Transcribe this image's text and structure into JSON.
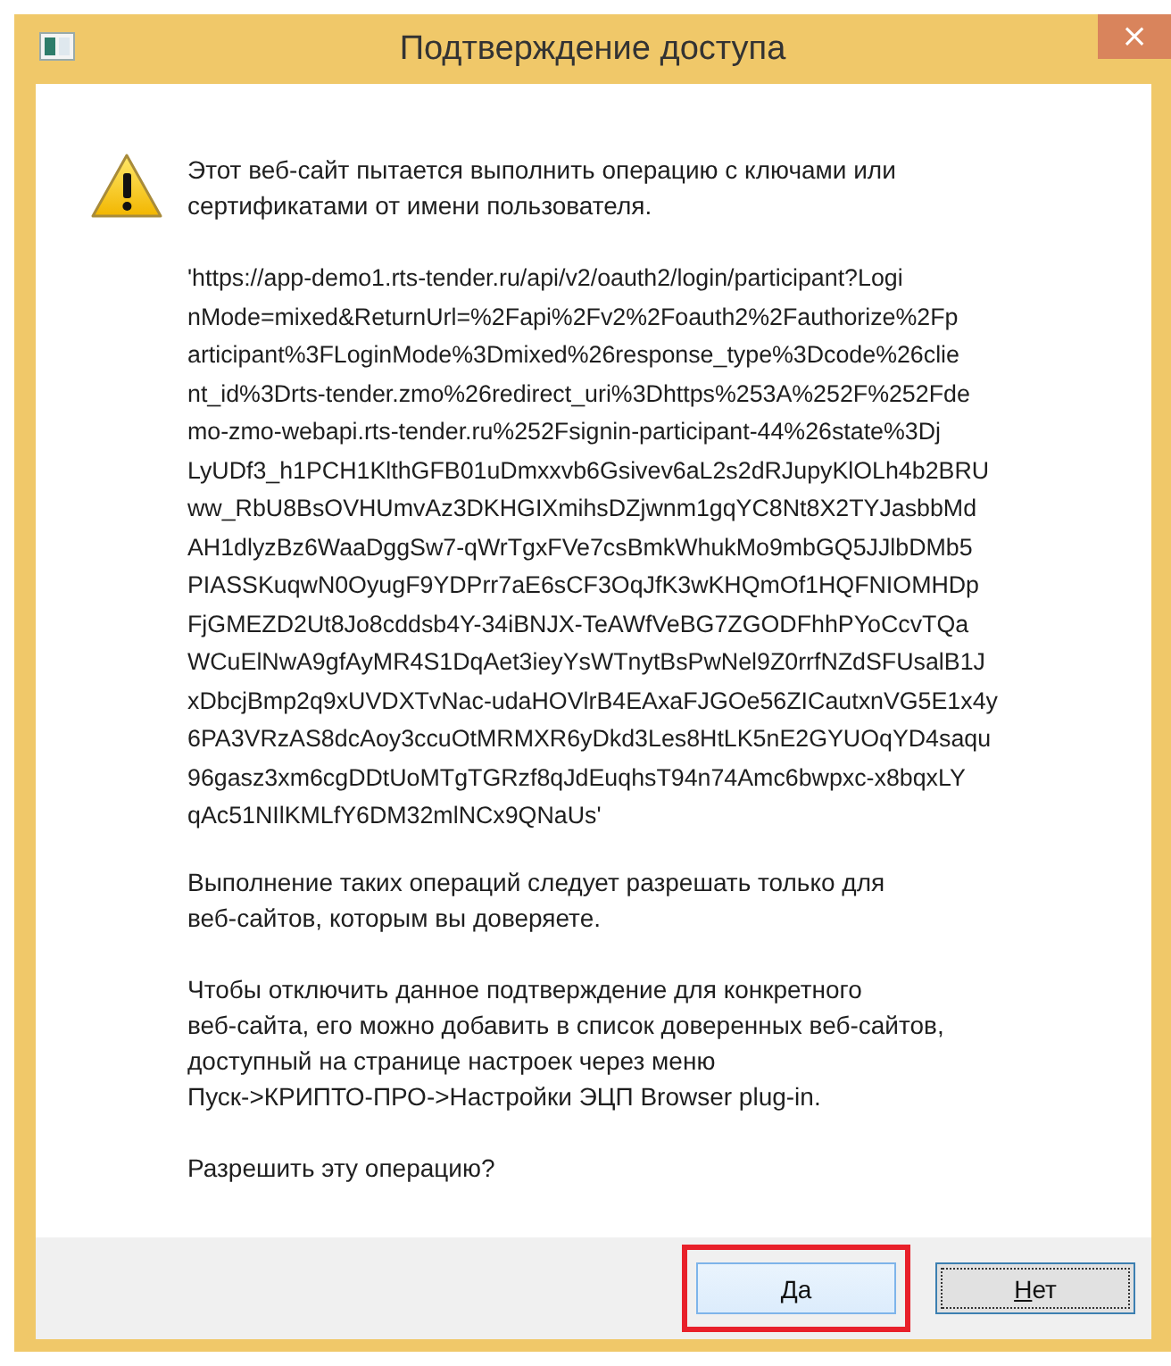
{
  "window": {
    "title": "Подтверждение доступа",
    "close": "×"
  },
  "message": {
    "intro": "Этот веб-сайт пытается выполнить операцию с ключами или\nсертификатами от имени пользователя.",
    "url_lines": [
      "'https://app-demo1.rts-tender.ru/api/v2/oauth2/login/participant?Logi",
      "nMode=mixed&ReturnUrl=%2Fapi%2Fv2%2Foauth2%2Fauthorize%2Fp",
      "articipant%3FLoginMode%3Dmixed%26response_type%3Dcode%26clie",
      "nt_id%3Drts-tender.zmo%26redirect_uri%3Dhttps%253A%252F%252Fde",
      "mo-zmo-webapi.rts-tender.ru%252Fsignin-participant-44%26state%3Dj",
      "LyUDf3_h1PCH1KlthGFB01uDmxxvb6Gsivev6aL2s2dRJupyKlOLh4b2BRU",
      "ww_RbU8BsOVHUmvAz3DKHGIXmihsDZjwnm1gqYC8Nt8X2TYJasbbMd",
      "AH1dlyzBz6WaaDggSw7-qWrTgxFVe7csBmkWhukMo9mbGQ5JJlbDMb5",
      "PIASSKuqwN0OyugF9YDPrr7aE6sCF3OqJfK3wKHQmOf1HQFNIOMHDp",
      "FjGMEZD2Ut8Jo8cddsb4Y-34iBNJX-TeAWfVeBG7ZGODFhhPYoCcvTQa",
      "WCuElNwA9gfAyMR4S1DqAet3ieyYsWTnytBsPwNel9Z0rrfNZdSFUsalB1J",
      "xDbcjBmp2q9xUVDXTvNac-udaHOVlrB4EAxaFJGOe56ZICautxnVG5E1x4y",
      "6PA3VRzAS8dcAoy3ccuOtMRMXR6yDkd3Les8HtLK5nE2GYUOqYD4saqu",
      "96gasz3xm6cgDDtUoMTgTGRzf8qJdEuqhsT94n74Amc6bwpxc-x8bqxLY",
      "qAc51NIlKMLfY6DM32mlNCx9QNaUs'"
    ],
    "paragraphs": [
      "Выполнение таких операций следует разрешать только для\nвеб-сайтов, которым вы доверяете.",
      "Чтобы отключить данное подтверждение для конкретного\nвеб-сайта, его можно добавить в список доверенных веб-сайтов,\nдоступный на странице настроек через меню\nПуск->КРИПТО-ПРО->Настройки ЭЦП Browser plug-in.",
      "Разрешить эту операцию?"
    ]
  },
  "buttons": [
    {
      "label": "Да",
      "highlighted": true,
      "focused": false
    },
    {
      "label": "Нет",
      "highlighted": false,
      "focused": true
    }
  ]
}
